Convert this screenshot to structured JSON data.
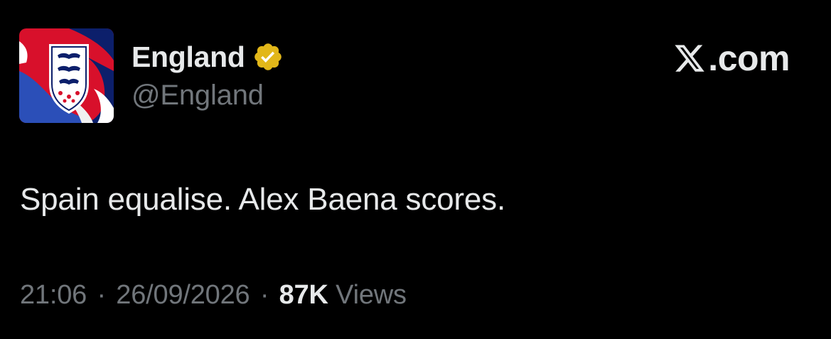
{
  "author": {
    "display_name": "England",
    "handle": "@England",
    "verified_icon": "verified-badge-icon",
    "avatar_icon": "three-lions-crest-icon"
  },
  "brand": {
    "icon": "x-logo-icon",
    "label": ".com"
  },
  "tweet": {
    "text": "Spain equalise. Alex Baena scores."
  },
  "meta": {
    "time": "21:06",
    "separator": "·",
    "date": "26/09/2026",
    "views_count": "87K",
    "views_label": "Views"
  },
  "colors": {
    "background": "#000000",
    "primary_text": "#e7e9ea",
    "secondary_text": "#71767b",
    "verified_gold": "#e2b719",
    "avatar_red": "#d8102b",
    "avatar_navy": "#0c1f6b",
    "avatar_blue": "#2b4fb8"
  }
}
